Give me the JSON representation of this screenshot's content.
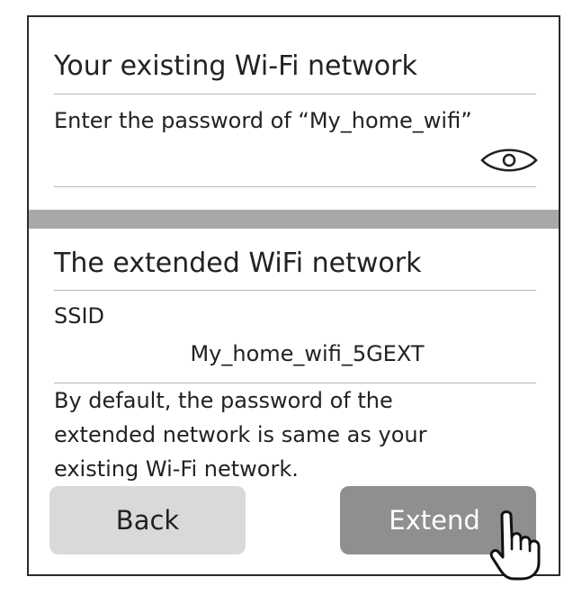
{
  "existing_network": {
    "heading": "Your existing Wi-Fi network",
    "password_prompt": "Enter the password of “My_home_wifi”",
    "password_value": "",
    "visibility_icon": "eye-icon"
  },
  "extended_network": {
    "heading": "The extended WiFi network",
    "ssid_label": "SSID",
    "ssid_value": "My_home_wifi_5GEXT",
    "note_lines": [
      "By default, the password of the",
      "extended network is same as your",
      "existing Wi-Fi network."
    ]
  },
  "buttons": {
    "back_label": "Back",
    "extend_label": "Extend"
  },
  "cursor_icon": "tap-hand-icon",
  "colors": {
    "border": "#2b2b2b",
    "section_divider": "#a8a8a8",
    "back_button": "#d9d9d9",
    "extend_button": "#8f8f8f",
    "extend_text": "#ffffff"
  }
}
